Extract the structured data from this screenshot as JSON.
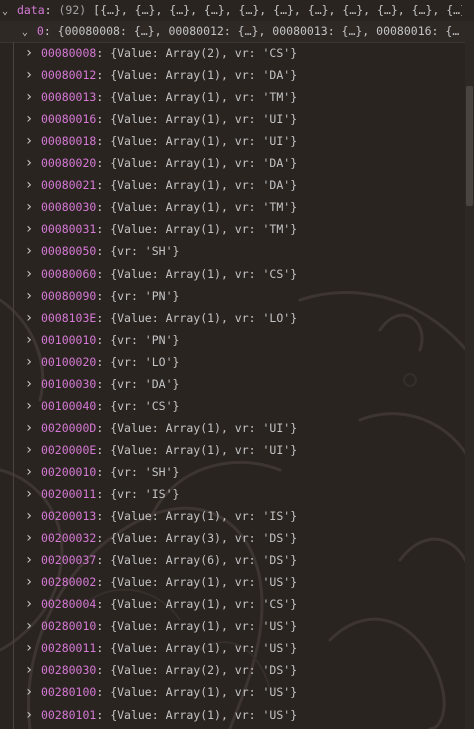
{
  "header": {
    "key": "data",
    "count": "(92)",
    "preview": "[{…}, {…}, {…}, {…}, {…}, {…}, {…}, {…}, {…}, {…}, {…}, …"
  },
  "item0": {
    "key": "0",
    "preview": "{00080008: {…}, 00080012: {…}, 00080013: {…}, 00080016: {…"
  },
  "rows": [
    {
      "tag": "00080008",
      "value": "{Value: Array(2), vr: 'CS'}"
    },
    {
      "tag": "00080012",
      "value": "{Value: Array(1), vr: 'DA'}"
    },
    {
      "tag": "00080013",
      "value": "{Value: Array(1), vr: 'TM'}"
    },
    {
      "tag": "00080016",
      "value": "{Value: Array(1), vr: 'UI'}"
    },
    {
      "tag": "00080018",
      "value": "{Value: Array(1), vr: 'UI'}"
    },
    {
      "tag": "00080020",
      "value": "{Value: Array(1), vr: 'DA'}"
    },
    {
      "tag": "00080021",
      "value": "{Value: Array(1), vr: 'DA'}"
    },
    {
      "tag": "00080030",
      "value": "{Value: Array(1), vr: 'TM'}"
    },
    {
      "tag": "00080031",
      "value": "{Value: Array(1), vr: 'TM'}"
    },
    {
      "tag": "00080050",
      "value": "{vr: 'SH'}"
    },
    {
      "tag": "00080060",
      "value": "{Value: Array(1), vr: 'CS'}"
    },
    {
      "tag": "00080090",
      "value": "{vr: 'PN'}"
    },
    {
      "tag": "0008103E",
      "value": "{Value: Array(1), vr: 'LO'}"
    },
    {
      "tag": "00100010",
      "value": "{vr: 'PN'}"
    },
    {
      "tag": "00100020",
      "value": "{vr: 'LO'}"
    },
    {
      "tag": "00100030",
      "value": "{vr: 'DA'}"
    },
    {
      "tag": "00100040",
      "value": "{vr: 'CS'}"
    },
    {
      "tag": "0020000D",
      "value": "{Value: Array(1), vr: 'UI'}"
    },
    {
      "tag": "0020000E",
      "value": "{Value: Array(1), vr: 'UI'}"
    },
    {
      "tag": "00200010",
      "value": "{vr: 'SH'}"
    },
    {
      "tag": "00200011",
      "value": "{vr: 'IS'}"
    },
    {
      "tag": "00200013",
      "value": "{Value: Array(1), vr: 'IS'}"
    },
    {
      "tag": "00200032",
      "value": "{Value: Array(3), vr: 'DS'}"
    },
    {
      "tag": "00200037",
      "value": "{Value: Array(6), vr: 'DS'}"
    },
    {
      "tag": "00280002",
      "value": "{Value: Array(1), vr: 'US'}"
    },
    {
      "tag": "00280004",
      "value": "{Value: Array(1), vr: 'CS'}"
    },
    {
      "tag": "00280010",
      "value": "{Value: Array(1), vr: 'US'}"
    },
    {
      "tag": "00280011",
      "value": "{Value: Array(1), vr: 'US'}"
    },
    {
      "tag": "00280030",
      "value": "{Value: Array(2), vr: 'DS'}"
    },
    {
      "tag": "00280100",
      "value": "{Value: Array(1), vr: 'US'}"
    },
    {
      "tag": "00280101",
      "value": "{Value: Array(1), vr: 'US'}"
    }
  ],
  "icons": {
    "collapse": "chevron-down-icon",
    "expand": "chevron-right-icon"
  },
  "colors": {
    "background": "#2a2421",
    "key": "#d479d4",
    "text": "#c4c4c4"
  }
}
